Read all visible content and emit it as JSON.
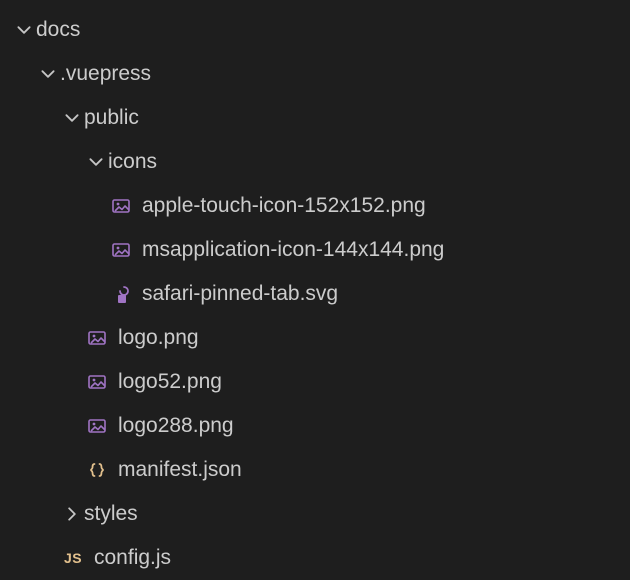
{
  "tree": {
    "docs": "docs",
    "vuepress": ".vuepress",
    "public": "public",
    "icons": "icons",
    "apple": "apple-touch-icon-152x152.png",
    "msapp": "msapplication-icon-144x144.png",
    "safari": "safari-pinned-tab.svg",
    "logo": "logo.png",
    "logo52": "logo52.png",
    "logo288": "logo288.png",
    "manifest": "manifest.json",
    "styles": "styles",
    "config": "config.js"
  },
  "colors": {
    "image": "#a074c4",
    "svg": "#a074c4",
    "json": "#e2c08d",
    "js": "#e2c08d",
    "chevron": "#c5c5c5"
  }
}
